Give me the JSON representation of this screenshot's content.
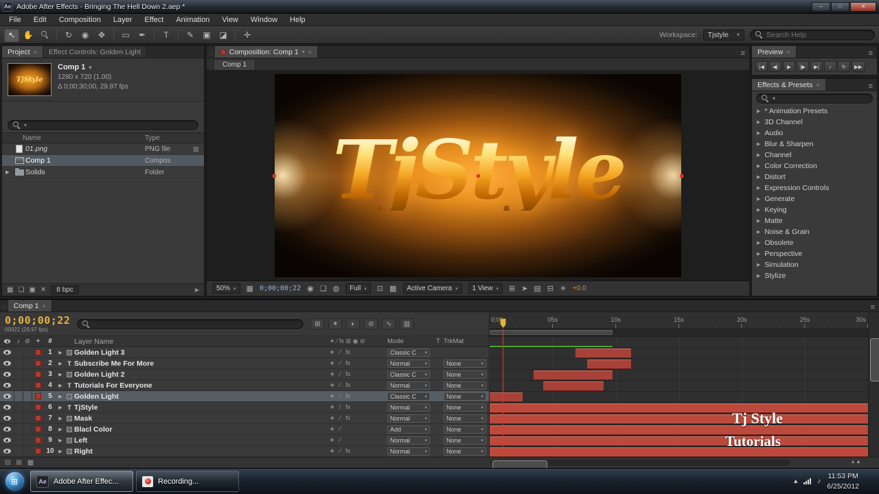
{
  "window": {
    "title": "Adobe After Effects - Bringing The Hell Down 2.aep *",
    "app_icon_text": "Ae"
  },
  "colors": {
    "bar_red": "#a84138",
    "block_red": "#bb4a3d",
    "accent_red": "#b03a30",
    "timecode_gold": "#e3b341",
    "cti_red": "#e03a2c",
    "green_line": "#49a52f"
  },
  "menu": {
    "items": [
      "File",
      "Edit",
      "Composition",
      "Layer",
      "Effect",
      "Animation",
      "View",
      "Window",
      "Help"
    ]
  },
  "toolbar": {
    "tools": [
      {
        "name": "selection-tool",
        "glyph": "↖",
        "active": true
      },
      {
        "name": "hand-tool",
        "glyph": "✋"
      },
      {
        "name": "zoom-tool",
        "mag": true,
        "sep": true
      },
      {
        "name": "rotation-tool",
        "glyph": "↻"
      },
      {
        "name": "unified-camera-tool",
        "glyph": "◉"
      },
      {
        "name": "pan-behind-tool",
        "glyph": "✥",
        "sep": true
      },
      {
        "name": "mask-shape-tool",
        "glyph": "▭"
      },
      {
        "name": "pen-tool",
        "glyph": "✒",
        "sep": true
      },
      {
        "name": "type-tool",
        "glyph": "T",
        "sep": true
      },
      {
        "name": "brush-tool",
        "glyph": "✎"
      },
      {
        "name": "clone-stamp-tool",
        "glyph": "▣"
      },
      {
        "name": "eraser-tool",
        "glyph": "◪",
        "sep": true
      },
      {
        "name": "puppet-pin-tool",
        "glyph": "✛"
      }
    ],
    "workspace_label": "Workspace:",
    "workspace_value": "Tjstyle",
    "search_placeholder": "Search Help"
  },
  "project": {
    "tab_project": "Project",
    "tab_effect_controls": "Effect Controls: Golden Light",
    "comp_name": "Comp 1",
    "info_line1": "1280 x 720 (1.00)",
    "info_line2": "Δ 0;00;30;00, 29.97 fps",
    "columns": {
      "name": "Name",
      "type": "Type"
    },
    "items": [
      {
        "name": "01.png",
        "type": "PNG file",
        "kind": "footage",
        "badge": "▥"
      },
      {
        "name": "Comp 1",
        "type": "Compos",
        "kind": "comp",
        "selected": true
      },
      {
        "name": "Solids",
        "type": "Folder",
        "kind": "folder"
      }
    ],
    "footer_icons": [
      {
        "name": "interpret-footage-icon",
        "glyph": "▦"
      },
      {
        "name": "new-folder-icon",
        "glyph": "❏"
      },
      {
        "name": "new-composition-icon",
        "glyph": "▣"
      },
      {
        "name": "delete-item-icon",
        "glyph": "✕"
      }
    ],
    "footer_depth": "8 bpc"
  },
  "comp_panel": {
    "tab": "Composition: Comp 1",
    "sub_tab": "Comp 1",
    "viewer_text": "TjStyle",
    "controls": [
      {
        "kind": "dd",
        "name": "magnification-dropdown",
        "value": "50%"
      },
      {
        "kind": "icon",
        "name": "grid-guides-icon",
        "glyph": "▦"
      },
      {
        "kind": "text",
        "name": "comp-timecode",
        "value": "0;00;00;22",
        "cls": "blue"
      },
      {
        "kind": "icon",
        "name": "snapshot-icon",
        "glyph": "◉"
      },
      {
        "kind": "icon",
        "name": "show-snapshot-icon",
        "glyph": "❏"
      },
      {
        "kind": "icon",
        "name": "show-channel-icon",
        "glyph": "◍"
      },
      {
        "kind": "dd",
        "name": "resolution-dropdown",
        "value": "Full"
      },
      {
        "kind": "icon",
        "name": "region-of-interest-icon",
        "glyph": "⊡"
      },
      {
        "kind": "icon",
        "name": "transparency-grid-icon",
        "glyph": "▩"
      },
      {
        "kind": "dd",
        "name": "camera-dropdown",
        "value": "Active Camera"
      },
      {
        "kind": "dd",
        "name": "view-layout-dropdown",
        "value": "1 View"
      },
      {
        "kind": "icon",
        "name": "pixel-aspect-correction-icon",
        "glyph": "⊞"
      },
      {
        "kind": "icon",
        "name": "fast-previews-icon",
        "glyph": "➤"
      },
      {
        "kind": "icon",
        "name": "timeline-button-icon",
        "glyph": "▤"
      },
      {
        "kind": "icon",
        "name": "flowchart-button-icon",
        "glyph": "⊟"
      },
      {
        "kind": "icon",
        "name": "exposure-icon",
        "glyph": "☀"
      },
      {
        "kind": "text",
        "name": "exposure-value",
        "value": "+0.0",
        "cls": "orange"
      }
    ]
  },
  "preview": {
    "tab": "Preview",
    "buttons": [
      {
        "name": "first-frame-button",
        "glyph": "|◀"
      },
      {
        "name": "previous-frame-button",
        "glyph": "◀|"
      },
      {
        "name": "play-button",
        "glyph": "▶"
      },
      {
        "name": "next-frame-button",
        "glyph": "|▶"
      },
      {
        "name": "last-frame-button",
        "glyph": "▶|"
      },
      {
        "name": "audio-toggle-button",
        "glyph": "♪"
      },
      {
        "name": "loop-button",
        "glyph": "↻"
      },
      {
        "name": "ram-preview-button",
        "glyph": "▶▶"
      }
    ]
  },
  "effects": {
    "tab": "Effects & Presets",
    "items": [
      "* Animation Presets",
      "3D Channel",
      "Audio",
      "Blur & Sharpen",
      "Channel",
      "Color Correction",
      "Distort",
      "Expression Controls",
      "Generate",
      "Keying",
      "Matte",
      "Noise & Grain",
      "Obsolete",
      "Perspective",
      "Simulation",
      "Stylize"
    ]
  },
  "timeline": {
    "tab": "Comp 1",
    "timecode": "0;00;00;22",
    "timecode_sub": "00022 (29.97 fps)",
    "toolbar_icons": [
      {
        "name": "live-update-icon",
        "glyph": "⊞"
      },
      {
        "name": "draft-3d-icon",
        "glyph": "✶"
      },
      {
        "name": "hide-shy-layers-icon",
        "glyph": "◐"
      },
      {
        "name": "frame-blend-icon",
        "glyph": "⊘"
      },
      {
        "name": "motion-blur-icon",
        "glyph": "∿"
      },
      {
        "name": "graph-editor-icon",
        "glyph": "▥"
      }
    ],
    "columns": {
      "hash": "#",
      "layer_name": "Layer Name",
      "switches": "✶ ∕ fx ⊞ ◉ ⊘",
      "mode": "Mode",
      "t": "T",
      "trkmat": "TrkMat"
    },
    "ruler_labels": [
      {
        "t": "0;00",
        "f": 0
      },
      {
        "t": "05s",
        "f": 0.1667
      },
      {
        "t": "10s",
        "f": 0.3333
      },
      {
        "t": "15s",
        "f": 0.5
      },
      {
        "t": "20s",
        "f": 0.6667
      },
      {
        "t": "25s",
        "f": 0.8333
      },
      {
        "t": "30s",
        "f": 1.0
      }
    ],
    "cti_fraction": 0.035,
    "work_area_fraction": 0.325,
    "layers": [
      {
        "num": "1",
        "name": "Golden Light 3",
        "type": "solid",
        "mode": "Classic C",
        "trkmat": null,
        "fx": true,
        "bar": [
          0.226,
          0.374
        ],
        "selected": false
      },
      {
        "num": "2",
        "name": "Subscribe Me  For More",
        "type": "text",
        "mode": "Normal",
        "trkmat": "None",
        "fx": true,
        "bar": [
          0.257,
          0.374
        ],
        "selected": false
      },
      {
        "num": "3",
        "name": "Golden Light 2",
        "type": "solid",
        "mode": "Classic C",
        "trkmat": "None",
        "fx": true,
        "bar": [
          0.117,
          0.325
        ],
        "selected": false
      },
      {
        "num": "4",
        "name": "Tutorials For  Everyone",
        "type": "text",
        "mode": "Normal",
        "trkmat": "None",
        "fx": true,
        "bar": [
          0.142,
          0.301
        ],
        "selected": false
      },
      {
        "num": "5",
        "name": "Golden Light",
        "type": "solid",
        "mode": "Classic C",
        "trkmat": "None",
        "fx": true,
        "bar": [
          0.0,
          0.088
        ],
        "selected": true
      },
      {
        "num": "6",
        "name": "TjStyle",
        "type": "text",
        "mode": "Normal",
        "trkmat": "None",
        "fx": true,
        "bar": [
          0,
          1
        ],
        "selected": false
      },
      {
        "num": "7",
        "name": "Mask",
        "type": "solid",
        "mode": "Normal",
        "trkmat": "None",
        "fx": true,
        "bar": [
          0,
          1
        ],
        "selected": false
      },
      {
        "num": "8",
        "name": "Blacl Color",
        "type": "solid",
        "mode": "Add",
        "trkmat": "None",
        "fx": false,
        "bar": [
          0,
          1
        ],
        "selected": false
      },
      {
        "num": "9",
        "name": "Left",
        "type": "solid",
        "mode": "Normal",
        "trkmat": "None",
        "fx": false,
        "bar": [
          0,
          1
        ],
        "selected": false
      },
      {
        "num": "10",
        "name": "Right",
        "type": "solid",
        "mode": "Normal",
        "trkmat": "None",
        "fx": true,
        "bar": [
          0,
          1
        ],
        "selected": false
      }
    ],
    "watermark": [
      "Tj Style",
      "Tutorials"
    ]
  },
  "taskbar": {
    "apps": [
      {
        "label": "Adobe After Effec...",
        "icon": "ae",
        "active": true
      },
      {
        "label": "Recording...",
        "icon": "rec",
        "active": false
      }
    ],
    "clock_time": "11:53 PM",
    "clock_date": "6/25/2012"
  }
}
